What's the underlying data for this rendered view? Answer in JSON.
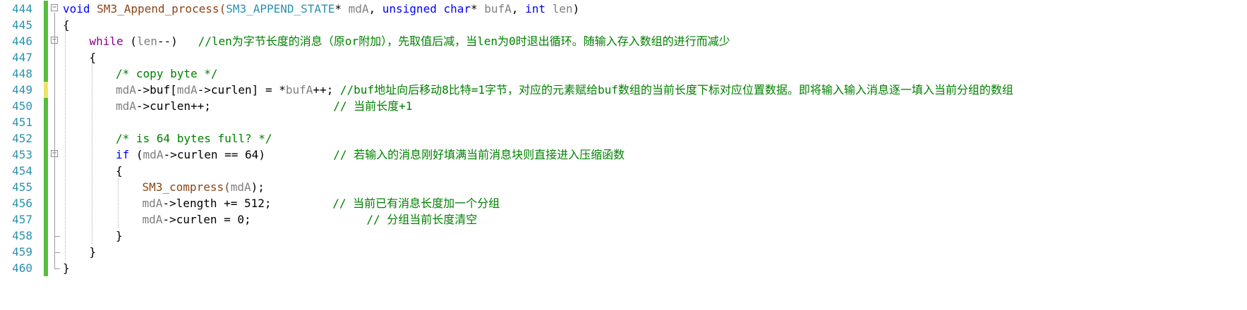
{
  "editor": {
    "lines": [
      {
        "num": "444",
        "fold": "−",
        "mark": "green",
        "indent": 0,
        "tokens": [
          {
            "t": "void ",
            "c": "kw"
          },
          {
            "t": "SM3_Append_process(",
            "c": "fn"
          },
          {
            "t": "SM3_APPEND_STATE",
            "c": "ty"
          },
          {
            "t": "* ",
            "c": "op"
          },
          {
            "t": "mdA",
            "c": "var"
          },
          {
            "t": ", ",
            "c": "op"
          },
          {
            "t": "unsigned char",
            "c": "kw"
          },
          {
            "t": "* ",
            "c": "op"
          },
          {
            "t": "bufA",
            "c": "var"
          },
          {
            "t": ", ",
            "c": "op"
          },
          {
            "t": "int ",
            "c": "kw"
          },
          {
            "t": "len",
            "c": "var"
          },
          {
            "t": ")",
            "c": "op"
          }
        ]
      },
      {
        "num": "445",
        "fold": "",
        "mark": "green",
        "indent": 0,
        "tokens": [
          {
            "t": "{",
            "c": "op"
          }
        ]
      },
      {
        "num": "446",
        "fold": "−",
        "mark": "green",
        "indent": 1,
        "tokens": [
          {
            "t": "while ",
            "c": "kw2"
          },
          {
            "t": "(",
            "c": "op"
          },
          {
            "t": "len",
            "c": "var"
          },
          {
            "t": "--)   ",
            "c": "op"
          },
          {
            "t": "//len为字节长度的消息（原or附加），先取值后减，当len为0时退出循环。随输入存入数组的进行而减少",
            "c": "cm"
          }
        ]
      },
      {
        "num": "447",
        "fold": "",
        "mark": "green",
        "indent": 1,
        "tokens": [
          {
            "t": "{",
            "c": "op"
          }
        ]
      },
      {
        "num": "448",
        "fold": "",
        "mark": "green",
        "indent": 2,
        "tokens": [
          {
            "t": "/* copy byte */",
            "c": "cm"
          }
        ]
      },
      {
        "num": "449",
        "fold": "",
        "mark": "yellow",
        "indent": 2,
        "tokens": [
          {
            "t": "mdA",
            "c": "var"
          },
          {
            "t": "->buf[",
            "c": "op"
          },
          {
            "t": "mdA",
            "c": "var"
          },
          {
            "t": "->curlen] = *",
            "c": "op"
          },
          {
            "t": "bufA",
            "c": "var"
          },
          {
            "t": "++; ",
            "c": "op"
          },
          {
            "t": "//buf地址向后移动8比特=1字节，对应的元素赋给buf数组的当前长度下标对应位置数据。即将输入输入消息逐一填入当前分组的数组",
            "c": "cm"
          }
        ]
      },
      {
        "num": "450",
        "fold": "",
        "mark": "green",
        "indent": 2,
        "tokens": [
          {
            "t": "mdA",
            "c": "var"
          },
          {
            "t": "->curlen++;                  ",
            "c": "op"
          },
          {
            "t": "// 当前长度+1",
            "c": "cm"
          }
        ]
      },
      {
        "num": "451",
        "fold": "",
        "mark": "green",
        "indent": 2,
        "tokens": []
      },
      {
        "num": "452",
        "fold": "",
        "mark": "green",
        "indent": 2,
        "tokens": [
          {
            "t": "/* is 64 bytes full? */",
            "c": "cm"
          }
        ]
      },
      {
        "num": "453",
        "fold": "−",
        "mark": "green",
        "indent": 2,
        "tokens": [
          {
            "t": "if ",
            "c": "kw"
          },
          {
            "t": "(",
            "c": "op"
          },
          {
            "t": "mdA",
            "c": "var"
          },
          {
            "t": "->curlen == 64)          ",
            "c": "op"
          },
          {
            "t": "// 若输入的消息刚好填满当前消息块则直接进入压缩函数",
            "c": "cm"
          }
        ]
      },
      {
        "num": "454",
        "fold": "",
        "mark": "green",
        "indent": 2,
        "tokens": [
          {
            "t": "{",
            "c": "op"
          }
        ]
      },
      {
        "num": "455",
        "fold": "",
        "mark": "green",
        "indent": 3,
        "tokens": [
          {
            "t": "SM3_compress(",
            "c": "fn"
          },
          {
            "t": "mdA",
            "c": "var"
          },
          {
            "t": ");",
            "c": "op"
          }
        ]
      },
      {
        "num": "456",
        "fold": "",
        "mark": "green",
        "indent": 3,
        "tokens": [
          {
            "t": "mdA",
            "c": "var"
          },
          {
            "t": "->length += 512;         ",
            "c": "op"
          },
          {
            "t": "// 当前已有消息长度加一个分组",
            "c": "cm"
          }
        ]
      },
      {
        "num": "457",
        "fold": "",
        "mark": "green",
        "indent": 3,
        "tokens": [
          {
            "t": "mdA",
            "c": "var"
          },
          {
            "t": "->curlen = 0;                 ",
            "c": "op"
          },
          {
            "t": "// 分组当前长度清空",
            "c": "cm"
          }
        ]
      },
      {
        "num": "458",
        "fold": "",
        "mark": "green",
        "indent": 2,
        "tokens": [
          {
            "t": "}",
            "c": "op"
          }
        ]
      },
      {
        "num": "459",
        "fold": "",
        "mark": "green",
        "indent": 1,
        "tokens": [
          {
            "t": "}",
            "c": "op"
          }
        ]
      },
      {
        "num": "460",
        "fold": "",
        "mark": "green",
        "indent": 0,
        "tokens": [
          {
            "t": "}",
            "c": "op"
          }
        ]
      }
    ]
  }
}
